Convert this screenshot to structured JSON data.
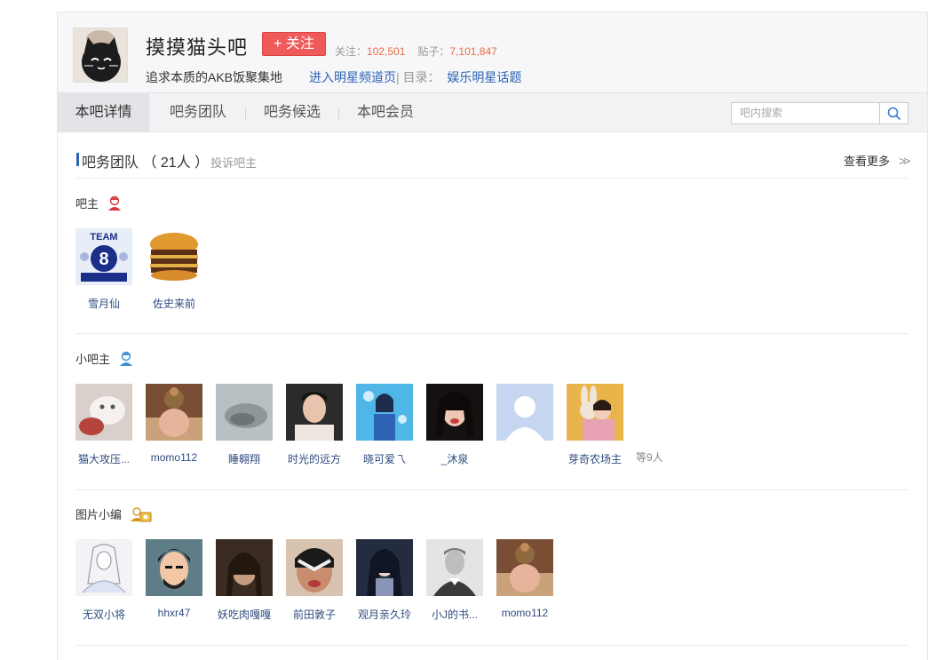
{
  "header": {
    "forum_name": "摸摸猫头吧",
    "follow_label": "+ 关注",
    "followers_label": "关注：",
    "followers_value": "102,501",
    "posts_label": "贴子：",
    "posts_value": "7,101,847",
    "slogan": "追求本质的AKB饭聚集地",
    "star_link": "进入明星频道页",
    "category_label": "| 目录：",
    "category_link": "娱乐明星话题"
  },
  "nav": {
    "tabs": [
      "本吧详情",
      "吧务团队",
      "吧务候选",
      "本吧会员"
    ],
    "search_placeholder": "吧内搜索"
  },
  "team": {
    "title": "吧务团队 （ 21人 ）",
    "complain": "投诉吧主",
    "more": "查看更多",
    "groups": [
      {
        "title": "吧主",
        "members": [
          "雪月仙",
          "佐史来前"
        ]
      },
      {
        "title": "小吧主",
        "members": [
          "猫大攻压...",
          "momo112",
          "睡翱翔",
          "时光的远方",
          "晓可爱乁",
          "_沐泉",
          "",
          "芽奇农场主"
        ],
        "etc": "等9人"
      },
      {
        "title": "图片小编",
        "members": [
          "无双小将",
          "hhxr47",
          "妖吃肉嘎嘎",
          "前田敦子",
          "观月亲久玲",
          "小J的书...",
          "momo112"
        ]
      }
    ]
  }
}
